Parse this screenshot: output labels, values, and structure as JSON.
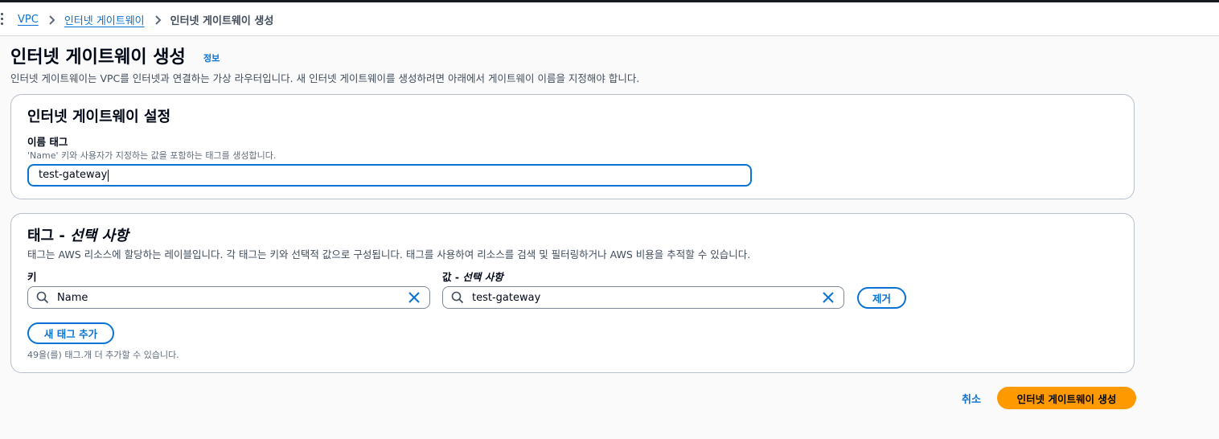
{
  "breadcrumb": {
    "items": [
      "VPC",
      "인터넷 게이트웨이"
    ],
    "current": "인터넷 게이트웨이 생성"
  },
  "page": {
    "title": "인터넷 게이트웨이 생성",
    "info_link": "정보",
    "description": "인터넷 게이트웨이는 VPC를 인터넷과 연결하는 가상 라우터입니다. 새 인터넷 게이트웨이를 생성하려면 아래에서 게이트웨이 이름을 지정해야 합니다."
  },
  "settings": {
    "heading": "인터넷 게이트웨이 설정",
    "name_tag_label": "이름 태그",
    "name_tag_hint": "'Name' 키와 사용자가 지정하는 값을 포함하는 태그를 생성합니다.",
    "name_tag_value": "test-gateway"
  },
  "tags": {
    "heading_main": "태그 - ",
    "heading_optional": "선택 사항",
    "description": "태그는 AWS 리소스에 할당하는 레이블입니다. 각 태그는 키와 선택적 값으로 구성됩니다. 태그를 사용하여 리소스를 검색 및 필터링하거나 AWS 비용을 추적할 수 있습니다.",
    "key_label": "키",
    "value_label_main": "값 - ",
    "value_label_optional": "선택 사항",
    "key_value": "Name",
    "value_value": "test-gateway",
    "remove_button": "제거",
    "add_button": "새 태그 추가",
    "limit_note": "49을(를) 태그.개 더 추가할 수 있습니다."
  },
  "footer": {
    "cancel": "취소",
    "create": "인터넷 게이트웨이 생성"
  },
  "colors": {
    "link": "#0972d3",
    "primary_button": "#ff9900",
    "background": "#fafafa",
    "card_border": "#b6bec9"
  }
}
